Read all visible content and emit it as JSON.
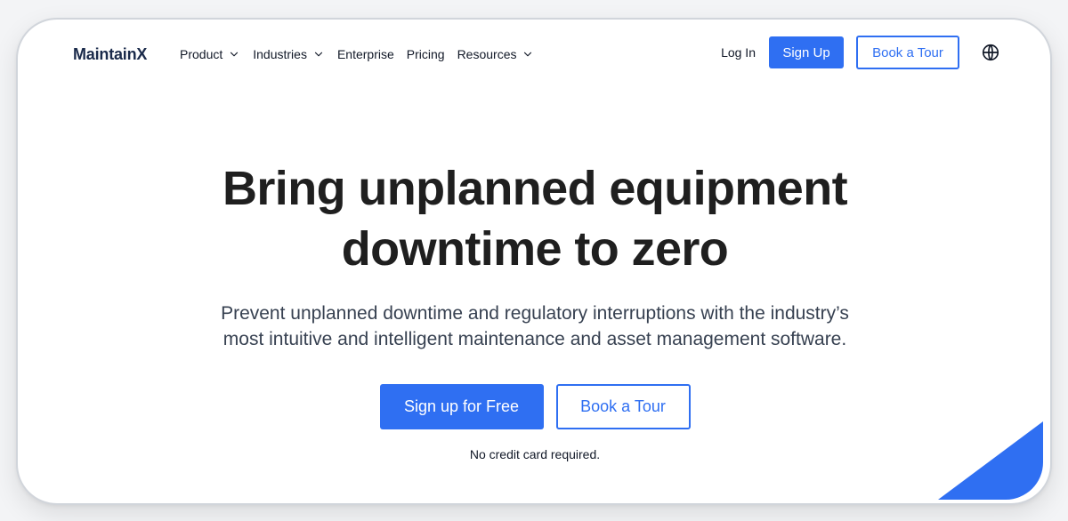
{
  "nav": {
    "logo_text": "MaintainX",
    "items": [
      {
        "label": "Product",
        "has_dropdown": true
      },
      {
        "label": "Industries",
        "has_dropdown": true
      },
      {
        "label": "Enterprise",
        "has_dropdown": false
      },
      {
        "label": "Pricing",
        "has_dropdown": false
      },
      {
        "label": "Resources",
        "has_dropdown": true
      }
    ],
    "login": "Log In",
    "signup": "Sign Up",
    "tour": "Book a Tour",
    "globe_icon": "globe-icon"
  },
  "hero": {
    "headline_line1": "Bring unplanned equipment",
    "headline_line2": "downtime to zero",
    "subhead_line1": "Prevent unplanned downtime and regulatory interruptions with the industry’s",
    "subhead_line2": "most intuitive and intelligent maintenance and asset management software.",
    "cta_primary": "Sign up for Free",
    "cta_secondary": "Book a Tour",
    "note": "No credit card required."
  },
  "colors": {
    "accent": "#2f6ff2",
    "text": "#1f1f1f",
    "logo": "#1a2a4a",
    "page_bg": "#f3f4f6"
  }
}
